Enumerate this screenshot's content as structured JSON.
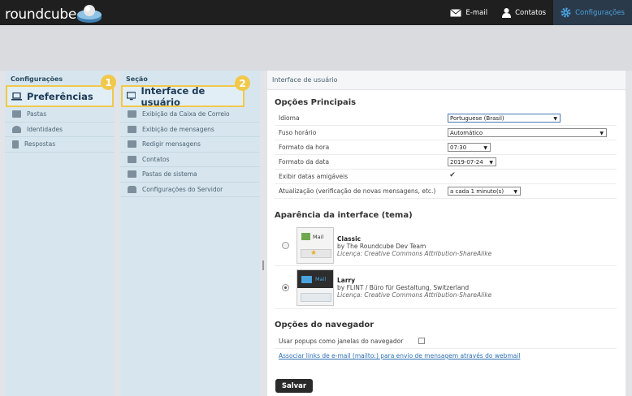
{
  "app": {
    "logo_text": "roundcube"
  },
  "topnav": [
    {
      "label": "E-mail",
      "icon": "envelope-icon"
    },
    {
      "label": "Contatos",
      "icon": "person-icon"
    },
    {
      "label": "Configurações",
      "icon": "gear-icon",
      "active": true
    }
  ],
  "settings_panel": {
    "header": "Configurações",
    "highlighted": "Preferências",
    "badge": "1",
    "items": [
      {
        "label": "Pastas",
        "icon": "folder-icon"
      },
      {
        "label": "Identidades",
        "icon": "person-icon"
      },
      {
        "label": "Respostas",
        "icon": "document-icon"
      }
    ]
  },
  "section_panel": {
    "header": "Seção",
    "highlighted": "Interface de usuário",
    "badge": "2",
    "items": [
      {
        "label": "Exibição da Caixa de Correio",
        "icon": "mailbox-icon"
      },
      {
        "label": "Exibição de mensagens",
        "icon": "message-view-icon"
      },
      {
        "label": "Redigir mensagens",
        "icon": "compose-icon"
      },
      {
        "label": "Contatos",
        "icon": "contacts-icon"
      },
      {
        "label": "Pastas de sistema",
        "icon": "folder-icon"
      },
      {
        "label": "Configurações do Servidor",
        "icon": "server-icon"
      }
    ]
  },
  "main": {
    "header": "Interface de usuário",
    "section1_title": "Opções Principais",
    "rows": [
      {
        "label": "Idioma",
        "value": "Portuguese (Brasil)"
      },
      {
        "label": "Fuso horário",
        "value": "Automático"
      },
      {
        "label": "Formato da hora",
        "value": "07:30"
      },
      {
        "label": "Formato da data",
        "value": "2019-07-24"
      },
      {
        "label": "Exibir datas amigáveis",
        "checked": true
      },
      {
        "label": "Atualização (verificação de novas mensagens, etc.)",
        "value": "a cada 1 minuto(s)"
      }
    ],
    "section2_title": "Aparência da interface (tema)",
    "themes": [
      {
        "name": "Classic",
        "by": "by The Roundcube Dev Team",
        "license": "Licença: Creative Commons Attribution-ShareAlike",
        "thumb_label": "Mail",
        "selected": false
      },
      {
        "name": "Larry",
        "by": "by FLINT / Büro für Gestaltung, Switzerland",
        "license": "Licença: Creative Commons Attribution-ShareAlike",
        "thumb_label": "Mail",
        "selected": true
      }
    ],
    "section3_title": "Opções do navegador",
    "popup_label": "Usar popups como janelas do navegador",
    "popup_checked": false,
    "mailto_link": "Associar links de e-mail (mailto:) para envio de mensagem através do webmail",
    "save_label": "Salvar"
  },
  "colors": {
    "accent": "#4aa3df",
    "highlight": "#f2c84b",
    "topbar": "#1f1f1f"
  }
}
